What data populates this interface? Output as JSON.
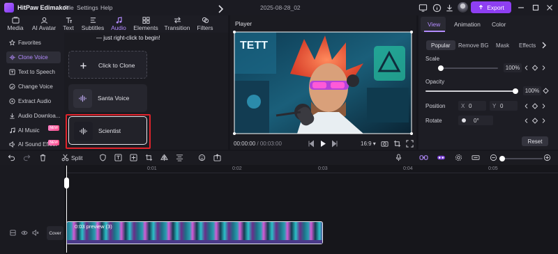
{
  "app": {
    "name": "HitPaw Edimakor",
    "project_name": "2025-08-28_02",
    "brand_color": "#8e3ff2"
  },
  "menu": [
    "File",
    "Settings",
    "Help"
  ],
  "header": {
    "export_label": "Export"
  },
  "media_tabs": [
    {
      "label": "Media",
      "icon": "media-icon"
    },
    {
      "label": "AI Avatar",
      "icon": "ai-avatar-icon"
    },
    {
      "label": "Text",
      "icon": "text-icon"
    },
    {
      "label": "Subtitles",
      "icon": "subtitles-icon"
    },
    {
      "label": "Audio",
      "icon": "audio-icon",
      "active": true
    },
    {
      "label": "Elements",
      "icon": "elements-icon"
    },
    {
      "label": "Transition",
      "icon": "transition-icon"
    },
    {
      "label": "Filters",
      "icon": "filters-icon"
    }
  ],
  "sidebar": {
    "items": [
      {
        "label": "Favorites",
        "icon": "star-icon"
      },
      {
        "label": "Clone Voice",
        "icon": "clone-voice-icon",
        "active": true
      },
      {
        "label": "Text to Speech",
        "icon": "text-to-speech-icon"
      },
      {
        "label": "Change Voice",
        "icon": "change-voice-icon"
      },
      {
        "label": "Extract Audio",
        "icon": "extract-audio-icon"
      },
      {
        "label": "Audio Downloa...",
        "icon": "download-icon"
      },
      {
        "label": "AI Music",
        "icon": "music-icon",
        "badge": "NEW"
      },
      {
        "label": "AI Sound Effect",
        "icon": "sound-effect-icon",
        "badge": "NEW"
      }
    ]
  },
  "voice_panel": {
    "hint": "— just right-click to begin!",
    "cards": [
      {
        "label": "Click to Clone",
        "icon": "plus-icon"
      },
      {
        "label": "Santa Voice",
        "icon": "waveform-icon"
      },
      {
        "label": "Scientist",
        "icon": "waveform-icon",
        "selected": true
      }
    ]
  },
  "player": {
    "title": "Player",
    "current_time": "00:00:00",
    "total_time": "00:03:00",
    "ratio": "16:9"
  },
  "right_panel": {
    "tabs": [
      "View",
      "Animation",
      "Color"
    ],
    "active_tab": "View",
    "subtabs": [
      "Popular",
      "Remove BG",
      "Mask",
      "Effects"
    ],
    "active_subtab": "Popular",
    "scale": {
      "label": "Scale",
      "value": "100%",
      "level": 1.0
    },
    "opacity": {
      "label": "Opacity",
      "value": "100%",
      "level": 1.0
    },
    "position": {
      "label": "Position",
      "x_label": "X",
      "x": "0",
      "y_label": "Y",
      "y": "0"
    },
    "rotate": {
      "label": "Rotate",
      "value": "0°"
    },
    "reset_label": "Reset"
  },
  "timeline_toolbar": {
    "split_label": "Split"
  },
  "timeline": {
    "ruler": [
      "0:01",
      "0:02",
      "0:03",
      "0:04",
      "0:05"
    ],
    "clip_label": "0:03 preview (3)",
    "cover_label": "Cover"
  }
}
